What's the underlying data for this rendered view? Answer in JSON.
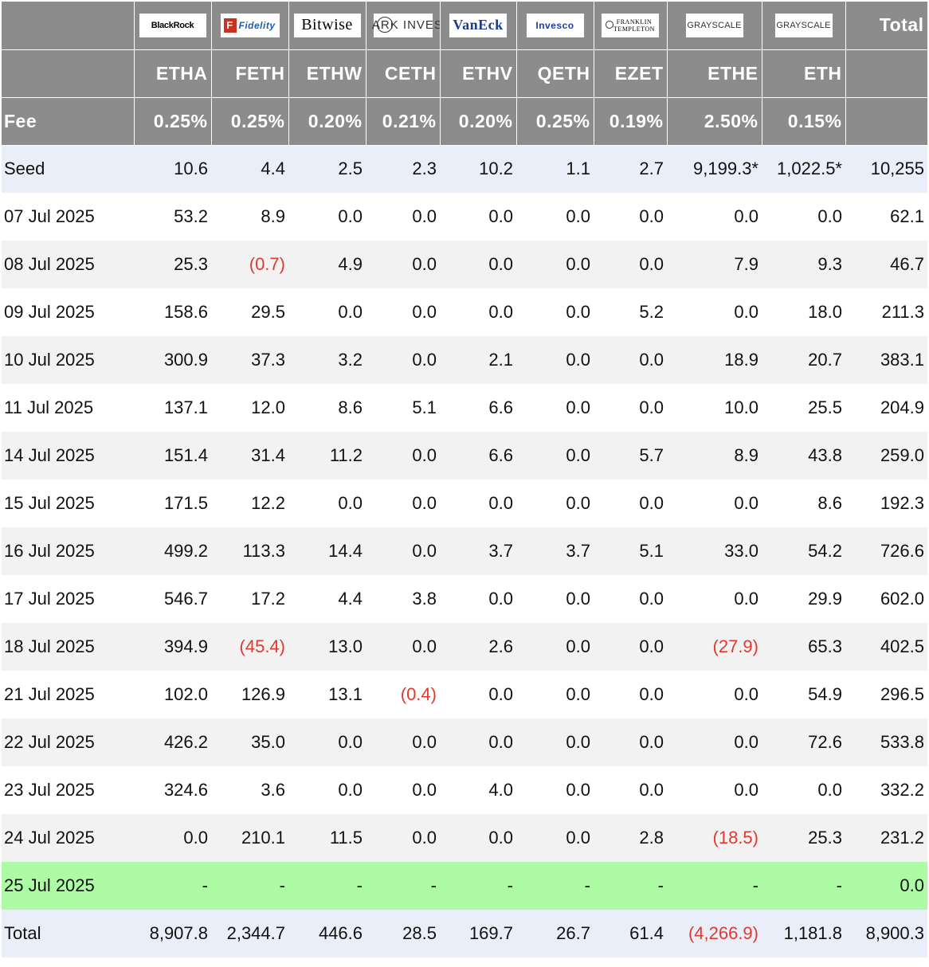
{
  "providers": [
    {
      "name": "BlackRock",
      "ticker": "ETHA",
      "fee": "0.25%"
    },
    {
      "name": "Fidelity",
      "ticker": "FETH",
      "fee": "0.25%"
    },
    {
      "name": "Bitwise",
      "ticker": "ETHW",
      "fee": "0.20%"
    },
    {
      "name": "ARK INVEST",
      "ticker": "CETH",
      "fee": "0.21%"
    },
    {
      "name": "VanEck",
      "ticker": "ETHV",
      "fee": "0.20%"
    },
    {
      "name": "Invesco",
      "ticker": "QETH",
      "fee": "0.25%"
    },
    {
      "name": "FRANKLIN TEMPLETON",
      "ticker": "EZET",
      "fee": "0.19%"
    },
    {
      "name": "GRAYSCALE",
      "ticker": "ETHE",
      "fee": "2.50%"
    },
    {
      "name": "GRAYSCALE",
      "ticker": "ETH",
      "fee": "0.15%"
    }
  ],
  "header": {
    "total_label": "Total",
    "fee_label": "Fee"
  },
  "colors": {
    "header_bg": "#8c8c8c",
    "seed_bg": "#e9eef8",
    "pending_bg": "#adfca5",
    "negative": "#e03a2f"
  },
  "rows": [
    {
      "date": "Seed",
      "values": [
        "10.6",
        "4.4",
        "2.5",
        "2.3",
        "10.2",
        "1.1",
        "2.7",
        "9,199.3*",
        "1,022.5*"
      ],
      "total": "10,255"
    },
    {
      "date": "07 Jul 2025",
      "values": [
        "53.2",
        "8.9",
        "0.0",
        "0.0",
        "0.0",
        "0.0",
        "0.0",
        "0.0",
        "0.0"
      ],
      "total": "62.1"
    },
    {
      "date": "08 Jul 2025",
      "values": [
        "25.3",
        "(0.7)",
        "4.9",
        "0.0",
        "0.0",
        "0.0",
        "0.0",
        "7.9",
        "9.3"
      ],
      "total": "46.7"
    },
    {
      "date": "09 Jul 2025",
      "values": [
        "158.6",
        "29.5",
        "0.0",
        "0.0",
        "0.0",
        "0.0",
        "5.2",
        "0.0",
        "18.0"
      ],
      "total": "211.3"
    },
    {
      "date": "10 Jul 2025",
      "values": [
        "300.9",
        "37.3",
        "3.2",
        "0.0",
        "2.1",
        "0.0",
        "0.0",
        "18.9",
        "20.7"
      ],
      "total": "383.1"
    },
    {
      "date": "11 Jul 2025",
      "values": [
        "137.1",
        "12.0",
        "8.6",
        "5.1",
        "6.6",
        "0.0",
        "0.0",
        "10.0",
        "25.5"
      ],
      "total": "204.9"
    },
    {
      "date": "14 Jul 2025",
      "values": [
        "151.4",
        "31.4",
        "11.2",
        "0.0",
        "6.6",
        "0.0",
        "5.7",
        "8.9",
        "43.8"
      ],
      "total": "259.0"
    },
    {
      "date": "15 Jul 2025",
      "values": [
        "171.5",
        "12.2",
        "0.0",
        "0.0",
        "0.0",
        "0.0",
        "0.0",
        "0.0",
        "8.6"
      ],
      "total": "192.3"
    },
    {
      "date": "16 Jul 2025",
      "values": [
        "499.2",
        "113.3",
        "14.4",
        "0.0",
        "3.7",
        "3.7",
        "5.1",
        "33.0",
        "54.2"
      ],
      "total": "726.6"
    },
    {
      "date": "17 Jul 2025",
      "values": [
        "546.7",
        "17.2",
        "4.4",
        "3.8",
        "0.0",
        "0.0",
        "0.0",
        "0.0",
        "29.9"
      ],
      "total": "602.0"
    },
    {
      "date": "18 Jul 2025",
      "values": [
        "394.9",
        "(45.4)",
        "13.0",
        "0.0",
        "2.6",
        "0.0",
        "0.0",
        "(27.9)",
        "65.3"
      ],
      "total": "402.5"
    },
    {
      "date": "21 Jul 2025",
      "values": [
        "102.0",
        "126.9",
        "13.1",
        "(0.4)",
        "0.0",
        "0.0",
        "0.0",
        "0.0",
        "54.9"
      ],
      "total": "296.5"
    },
    {
      "date": "22 Jul 2025",
      "values": [
        "426.2",
        "35.0",
        "0.0",
        "0.0",
        "0.0",
        "0.0",
        "0.0",
        "0.0",
        "72.6"
      ],
      "total": "533.8"
    },
    {
      "date": "23 Jul 2025",
      "values": [
        "324.6",
        "3.6",
        "0.0",
        "0.0",
        "4.0",
        "0.0",
        "0.0",
        "0.0",
        "0.0"
      ],
      "total": "332.2"
    },
    {
      "date": "24 Jul 2025",
      "values": [
        "0.0",
        "210.1",
        "11.5",
        "0.0",
        "0.0",
        "0.0",
        "2.8",
        "(18.5)",
        "25.3"
      ],
      "total": "231.2"
    },
    {
      "date": "25 Jul 2025",
      "values": [
        "-",
        "-",
        "-",
        "-",
        "-",
        "-",
        "-",
        "-",
        "-"
      ],
      "total": "0.0"
    }
  ],
  "totals": {
    "label": "Total",
    "values": [
      "8,907.8",
      "2,344.7",
      "446.6",
      "28.5",
      "169.7",
      "26.7",
      "61.4",
      "(4,266.9)",
      "1,181.8"
    ],
    "total": "8,900.3"
  }
}
